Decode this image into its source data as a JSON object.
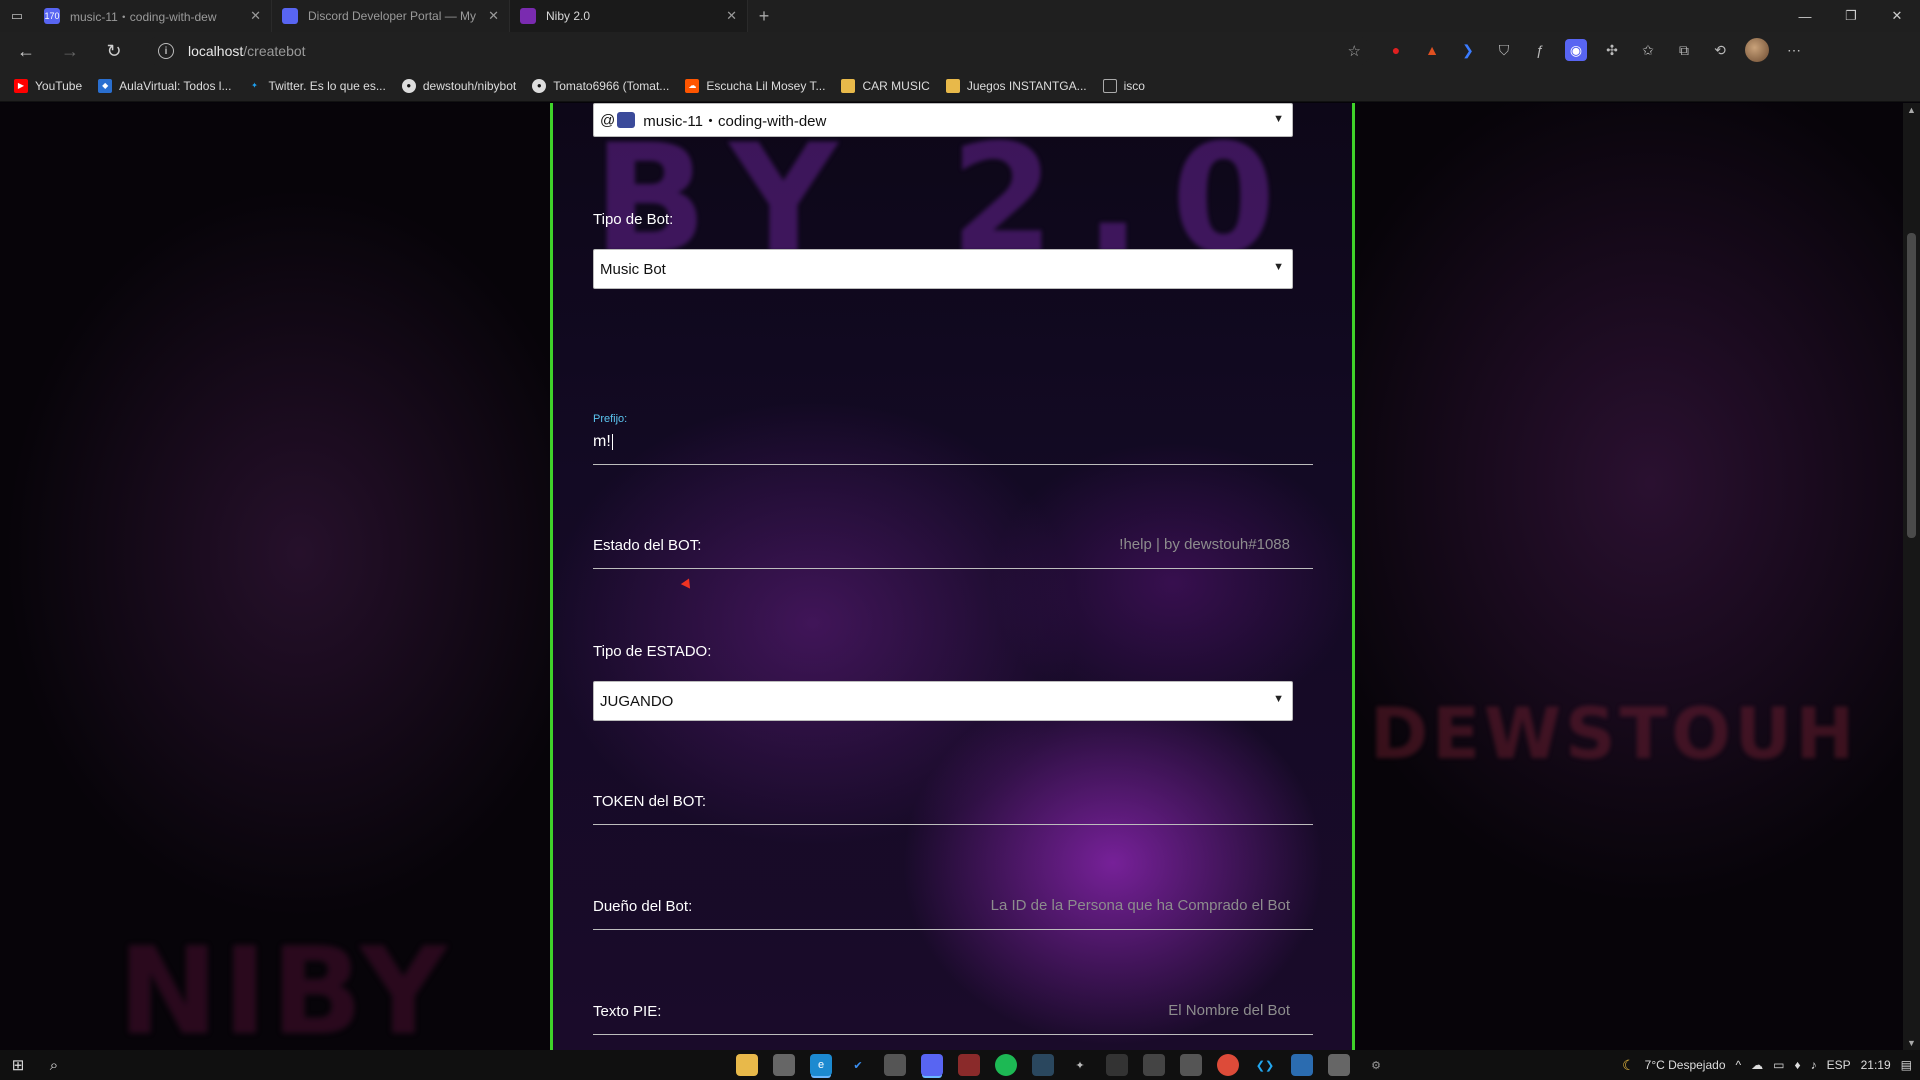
{
  "browser": {
    "tabs": [
      {
        "title": "music-11・coding-with-dew",
        "favicon_color": "#5865f2",
        "badge": "170",
        "active": false
      },
      {
        "title": "Discord Developer Portal — My",
        "favicon_color": "#5865f2",
        "active": false
      },
      {
        "title": "Niby 2.0",
        "favicon_color": "#7a2bb0",
        "active": true
      }
    ],
    "url_host": "localhost",
    "url_path": "/createbot",
    "bookmarks": [
      {
        "label": "YouTube",
        "icon": "youtube-icon",
        "color": "#ff0000"
      },
      {
        "label": "AulaVirtual: Todos l...",
        "icon": "moodle-icon",
        "color": "#2a6fd0"
      },
      {
        "label": "Twitter. Es lo que es...",
        "icon": "twitter-icon",
        "color": "#1da1f2"
      },
      {
        "label": "dewstouh/nibybot",
        "icon": "github-icon",
        "color": "#333333"
      },
      {
        "label": "Tomato6966 (Tomat...",
        "icon": "github-icon",
        "color": "#333333"
      },
      {
        "label": "Escucha Lil Mosey T...",
        "icon": "soundcloud-icon",
        "color": "#ff5500"
      },
      {
        "label": "CAR MUSIC",
        "icon": "folder-icon",
        "color": "#e8b94a"
      },
      {
        "label": "Juegos INSTANTGA...",
        "icon": "folder-icon",
        "color": "#e8b94a"
      },
      {
        "label": "isco",
        "icon": "page-icon",
        "color": "#888888"
      }
    ]
  },
  "form": {
    "channel_select": "music-11・coding-with-dew",
    "channel_prefix": "@",
    "bot_type_label": "Tipo de Bot:",
    "bot_type_value": "Music Bot",
    "prefix_label": "Prefijo:",
    "prefix_value": "m!",
    "status_label": "Estado del BOT:",
    "status_placeholder": "!help | by dewstouh#1088",
    "status_type_label": "Tipo de ESTADO:",
    "status_type_value": "JUGANDO",
    "token_label": "TOKEN del BOT:",
    "owner_label": "Dueño del Bot:",
    "owner_placeholder": "La ID de la Persona que ha Comprado el Bot",
    "footer_label": "Texto PIE:",
    "footer_placeholder": "El Nombre del Bot"
  },
  "background": {
    "panel_title": "BY 2.0",
    "left_brand": "NIBY",
    "right_brand": "DEWSTOUH"
  },
  "taskbar": {
    "weather": "7°C  Despejado",
    "language": "ESP",
    "time": "21:19"
  },
  "colors": {
    "panel_border": "#3fd22a",
    "prefix_label": "#5bc6f0"
  }
}
